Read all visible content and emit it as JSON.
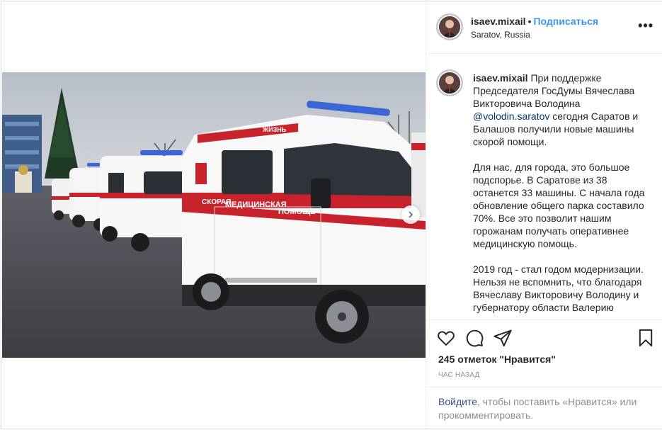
{
  "header": {
    "username": "isaev.mixail",
    "separator": "•",
    "follow_label": "Подписаться",
    "location": "Saratov, Russia",
    "more_label": "•••"
  },
  "comment": {
    "username": "isaev.mixail",
    "text_1": " При поддержке Председателя ГосДумы Вячеслава Викторовича Володина ",
    "mention": "@volodin.saratov",
    "text_2": " сегодня Саратов и Балашов получили новые машины скорой помощи.\n\nДля нас, для города, это большое подспорье. В Саратове из 38 останется 33 машины. С начала года обновление общего парка составило 70%. Все это позволит нашим горожанам получать оперативнее медицинскую помощь.\n\n2019 год - стал годом модернизации. Нельзя не вспомнить, что благодаря Вячеславу Викторовичу Володину и губернатору области Валерию"
  },
  "actions": {
    "like_icon": "heart-icon",
    "comment_icon": "comment-icon",
    "share_icon": "paper-plane-icon",
    "save_icon": "bookmark-icon"
  },
  "likes_text": "245 отметок \"Нравится\"",
  "time_text": "час назад",
  "login": {
    "link_label": "Войдите",
    "rest_text": ", чтобы поставить «Нравится» или прокомментировать."
  },
  "photo": {
    "ambulance_text_1": "СКОРАЯ",
    "ambulance_text_2": "МЕДИЦИНСКАЯ",
    "ambulance_text_3": "ПОМОЩЬ",
    "ambulance_roof_text": "ЖИЗНЬ"
  },
  "colors": {
    "accent": "#3897f0",
    "mention": "#003569",
    "ambulance_red": "#c8232c"
  }
}
